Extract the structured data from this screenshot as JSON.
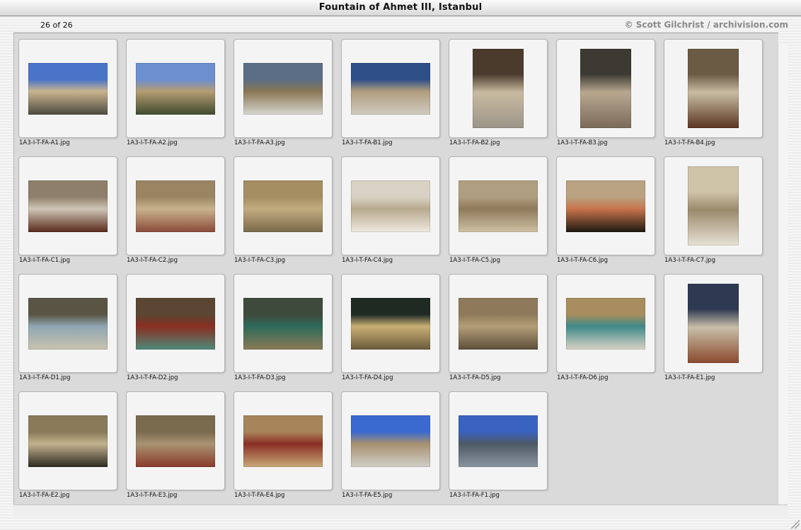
{
  "window": {
    "title": "Fountain of Ahmet III, Istanbul",
    "count_label": "26 of 26",
    "credit": "© Scott Gilchrist / archivision.com"
  },
  "thumbnails": [
    {
      "filename": "1A3-I-T-FA-A1.jpg",
      "orientation": "landscape",
      "colors": [
        "#4a74c8",
        "#c9b58e",
        "#4d4a3f"
      ]
    },
    {
      "filename": "1A3-I-T-FA-A2.jpg",
      "orientation": "landscape",
      "colors": [
        "#6b8fcf",
        "#b59c72",
        "#3f4a2e"
      ]
    },
    {
      "filename": "1A3-I-T-FA-A3.jpg",
      "orientation": "landscape",
      "colors": [
        "#5c6e86",
        "#8a7654",
        "#d6d6d0"
      ]
    },
    {
      "filename": "1A3-I-T-FA-B1.jpg",
      "orientation": "landscape",
      "colors": [
        "#2f4f88",
        "#b09d7e",
        "#cfcac0"
      ]
    },
    {
      "filename": "1A3-I-T-FA-B2.jpg",
      "orientation": "portrait",
      "colors": [
        "#4a3b2c",
        "#c8baa0",
        "#9b9588"
      ]
    },
    {
      "filename": "1A3-I-T-FA-B3.jpg",
      "orientation": "portrait",
      "colors": [
        "#3d3a33",
        "#b8a890",
        "#7a6a58"
      ]
    },
    {
      "filename": "1A3-I-T-FA-B4.jpg",
      "orientation": "portrait",
      "colors": [
        "#6b5a44",
        "#c9bca3",
        "#5a3520"
      ]
    },
    {
      "filename": "1A3-I-T-FA-C1.jpg",
      "orientation": "landscape",
      "colors": [
        "#8e7f6a",
        "#cfc6b6",
        "#5a2a1c"
      ]
    },
    {
      "filename": "1A3-I-T-FA-C2.jpg",
      "orientation": "landscape",
      "colors": [
        "#9a8462",
        "#c9b38e",
        "#8a4a38"
      ]
    },
    {
      "filename": "1A3-I-T-FA-C3.jpg",
      "orientation": "landscape",
      "colors": [
        "#a48e62",
        "#c2ac80",
        "#7a6a48"
      ]
    },
    {
      "filename": "1A3-I-T-FA-C4.jpg",
      "orientation": "landscape",
      "colors": [
        "#d9d2c4",
        "#b7a98e",
        "#efe9df"
      ]
    },
    {
      "filename": "1A3-I-T-FA-C5.jpg",
      "orientation": "landscape",
      "colors": [
        "#b09e80",
        "#8e7a5a",
        "#cfc1a4"
      ]
    },
    {
      "filename": "1A3-I-T-FA-C6.jpg",
      "orientation": "landscape",
      "colors": [
        "#b8a282",
        "#c9744c",
        "#1e1812"
      ]
    },
    {
      "filename": "1A3-I-T-FA-C7.jpg",
      "orientation": "portrait",
      "colors": [
        "#cfc3a8",
        "#9a8a6c",
        "#e7e1d3"
      ]
    },
    {
      "filename": "1A3-I-T-FA-D1.jpg",
      "orientation": "landscape",
      "colors": [
        "#5a5444",
        "#8fa6b2",
        "#c9c3b0"
      ]
    },
    {
      "filename": "1A3-I-T-FA-D2.jpg",
      "orientation": "landscape",
      "colors": [
        "#5a4632",
        "#8a2e22",
        "#4e8a7a"
      ]
    },
    {
      "filename": "1A3-I-T-FA-D3.jpg",
      "orientation": "landscape",
      "colors": [
        "#3e4a3c",
        "#2e6a5a",
        "#8a7a56"
      ]
    },
    {
      "filename": "1A3-I-T-FA-D4.jpg",
      "orientation": "landscape",
      "colors": [
        "#1e2a22",
        "#c9b076",
        "#6a5a3a"
      ]
    },
    {
      "filename": "1A3-I-T-FA-D5.jpg",
      "orientation": "landscape",
      "colors": [
        "#8e7a5a",
        "#b49e78",
        "#5e4e3a"
      ]
    },
    {
      "filename": "1A3-I-T-FA-D6.jpg",
      "orientation": "landscape",
      "colors": [
        "#a88e5e",
        "#3e8a8a",
        "#d9d3c4"
      ]
    },
    {
      "filename": "1A3-I-T-FA-E1.jpg",
      "orientation": "portrait",
      "colors": [
        "#2e3a52",
        "#c9bfa8",
        "#8a4a2e"
      ]
    },
    {
      "filename": "1A3-I-T-FA-E2.jpg",
      "orientation": "landscape",
      "colors": [
        "#8a7a5a",
        "#c2b28e",
        "#2e2a22"
      ]
    },
    {
      "filename": "1A3-I-T-FA-E3.jpg",
      "orientation": "landscape",
      "colors": [
        "#7a6a4e",
        "#a89472",
        "#8a3a2a"
      ]
    },
    {
      "filename": "1A3-I-T-FA-E4.jpg",
      "orientation": "landscape",
      "colors": [
        "#a8845a",
        "#8a2e22",
        "#c9a97a"
      ]
    },
    {
      "filename": "1A3-I-T-FA-E5.jpg",
      "orientation": "landscape",
      "colors": [
        "#3a6ad0",
        "#a89070",
        "#cfcfc8"
      ]
    },
    {
      "filename": "1A3-I-T-FA-F1.jpg",
      "orientation": "landscape",
      "colors": [
        "#3a62c0",
        "#4e5a66",
        "#8a94a0"
      ]
    }
  ]
}
